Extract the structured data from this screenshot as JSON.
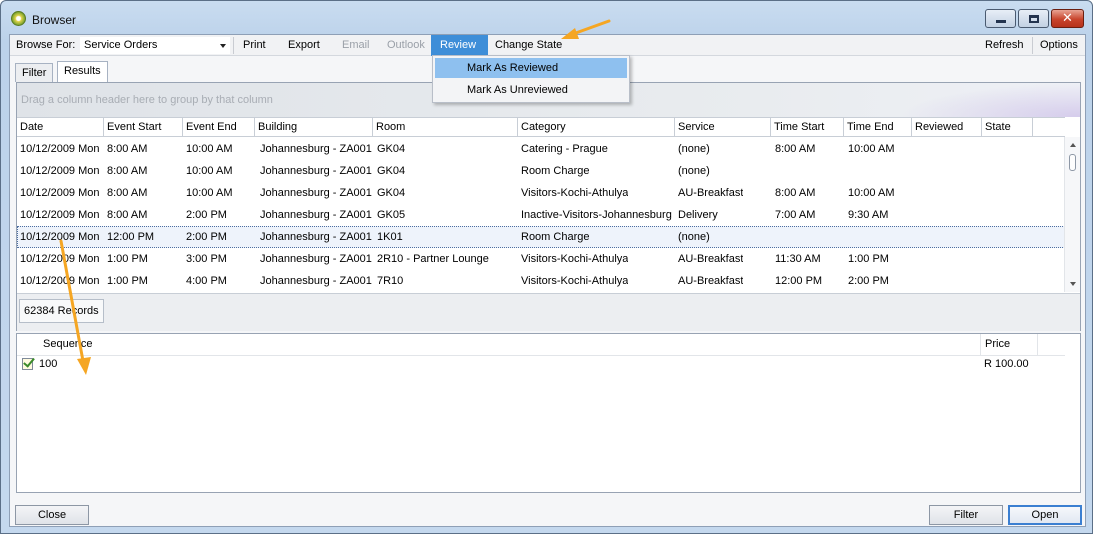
{
  "window": {
    "title": "Browser",
    "icon": "app-logo-icon",
    "controls": [
      "minimize",
      "maximize",
      "close"
    ],
    "close_glyph": "✕"
  },
  "menubar": {
    "browse_for_label": "Browse For:",
    "browse_for_value": "Service Orders",
    "print": "Print",
    "export": "Export",
    "email": "Email",
    "outlook": "Outlook",
    "review": "Review",
    "change_state": "Change State",
    "refresh": "Refresh",
    "options": "Options"
  },
  "tabs": [
    "Filter",
    "Results"
  ],
  "review_menu": {
    "items": [
      "Mark As Reviewed",
      "Mark As Unreviewed"
    ]
  },
  "grid": {
    "group_hint": "Drag a column header here to group by that column",
    "columns": [
      "Date",
      "Event Start",
      "Event End",
      "Building",
      "Room",
      "Category",
      "Service",
      "Time Start",
      "Time End",
      "Reviewed",
      "State"
    ],
    "rows": [
      [
        "10/12/2009 Mon",
        "8:00 AM",
        "10:00 AM",
        "Johannesburg - ZA001",
        "GK04",
        "Catering - Prague",
        "(none)",
        "8:00 AM",
        "10:00 AM",
        "",
        ""
      ],
      [
        "10/12/2009 Mon",
        "8:00 AM",
        "10:00 AM",
        "Johannesburg - ZA001",
        "GK04",
        "Room Charge",
        "(none)",
        "",
        "",
        "",
        ""
      ],
      [
        "10/12/2009 Mon",
        "8:00 AM",
        "10:00 AM",
        "Johannesburg - ZA001",
        "GK04",
        "Visitors-Kochi-Athulya",
        "AU-Breakfast",
        "8:00 AM",
        "10:00 AM",
        "",
        ""
      ],
      [
        "10/12/2009 Mon",
        "8:00 AM",
        "2:00 PM",
        "Johannesburg - ZA001",
        "GK05",
        "Inactive-Visitors-Johannesburg",
        "Delivery",
        "7:00 AM",
        "9:30 AM",
        "",
        ""
      ],
      [
        "10/12/2009 Mon",
        "12:00 PM",
        "2:00 PM",
        "Johannesburg - ZA001",
        "1K01",
        "Room Charge",
        "(none)",
        "",
        "",
        "",
        ""
      ],
      [
        "10/12/2009 Mon",
        "1:00 PM",
        "3:00 PM",
        "Johannesburg - ZA001",
        "2R10 - Partner Lounge",
        "Visitors-Kochi-Athulya",
        "AU-Breakfast",
        "11:30 AM",
        "1:00 PM",
        "",
        ""
      ],
      [
        "10/12/2009 Mon",
        "1:00 PM",
        "4:00 PM",
        "Johannesburg - ZA001",
        "7R10",
        "Visitors-Kochi-Athulya",
        "AU-Breakfast",
        "12:00 PM",
        "2:00 PM",
        "",
        ""
      ]
    ],
    "selected_row_index": 4,
    "record_count": "62384 Records"
  },
  "detail": {
    "columns": [
      "Sequence",
      "Price"
    ],
    "rows": [
      {
        "sequence": "100",
        "price": "R 100.00",
        "checked": true
      }
    ]
  },
  "buttons": {
    "close": "Close",
    "filter": "Filter",
    "open": "Open"
  },
  "colors": {
    "menu_active": "#3e8ed8",
    "menu_highlight": "#8ec0ef",
    "annotation_arrow": "#f5a623"
  }
}
